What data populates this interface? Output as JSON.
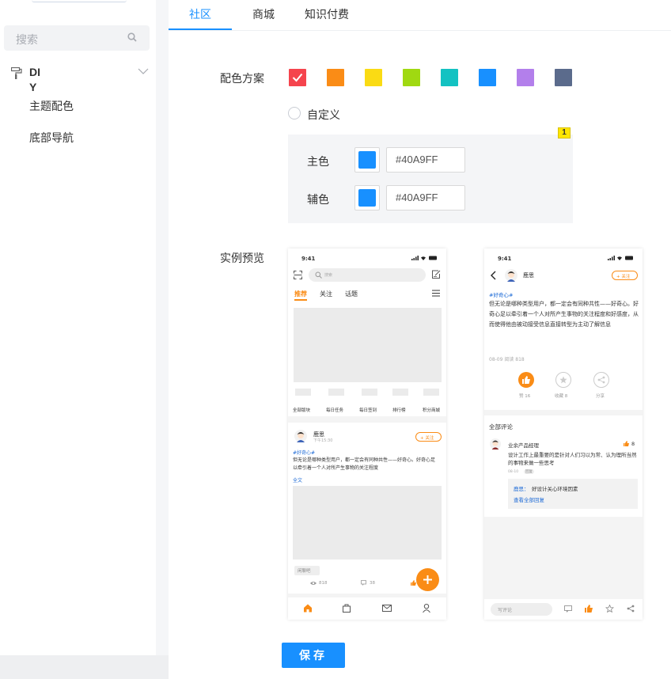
{
  "sidebar": {
    "search_placeholder": "搜索",
    "group_title": "DIY",
    "items": [
      "主题配色",
      "底部导航"
    ]
  },
  "tabs": [
    "社区",
    "商城",
    "知识付费"
  ],
  "form": {
    "color_scheme_label": "配色方案",
    "swatches": [
      "#f5444d",
      "#fa8c16",
      "#fadb14",
      "#a0d911",
      "#13c2c2",
      "#1890ff",
      "#b37feb",
      "#5b6b8c"
    ],
    "custom_label": "自定义",
    "badge": "1",
    "primary_label": "主色",
    "primary_value": "#40A9FF",
    "primary_color": "#1890ff",
    "secondary_label": "辅色",
    "secondary_value": "#40A9FF",
    "secondary_color": "#1890ff",
    "preview_label": "实例预览",
    "save_label": "保存"
  },
  "phone1": {
    "time": "9:41",
    "search_placeholder": "搜索",
    "tabs": [
      "推荐",
      "关注",
      "话题"
    ],
    "shortcuts": [
      "全部版块",
      "每日任务",
      "每日签到",
      "排行榜",
      "积分商城"
    ],
    "author": "鹿思",
    "post_time": "下午15:30",
    "follow": "+ 关注",
    "topic": "#好奇心#",
    "content": "但无论是哪种类型用户，都一定会有同种共性——好奇心。好奇心足以牵引着一个人对所产生事物的关注程度",
    "read_more": "全文",
    "tag": "闲聊吧",
    "stat1": "818",
    "stat2": "38",
    "accent": "#fa8c16"
  },
  "phone2": {
    "time": "9:41",
    "author": "鹿思",
    "follow": "+ 关注",
    "topic": "#好奇心#",
    "content": "但无论是哪种类型用户，都一定会有同种共性——好奇心。好奇心足以牵引着一个人对所产生事物的关注程度和好感度，从而使得他由被动接受信息直接转型为主动了解信息",
    "meta": "08-09 阅读 818",
    "like_label": "赞 16",
    "collect_label": "收藏 8",
    "share_label": "分享",
    "comments_title": "全部评论",
    "commenter": "业余产品经理",
    "comment_likes": "8",
    "comment_text": "设计工作上最重要的是针对人们习以为常、认为理所当然的事物来做一些思考",
    "comment_meta": "08-10",
    "comment_reply_btn": "回复",
    "reply_author": "鹿思：",
    "reply_text": "好设计关心环境因素",
    "view_all": "查看全部回复",
    "input_placeholder": "写评论"
  }
}
